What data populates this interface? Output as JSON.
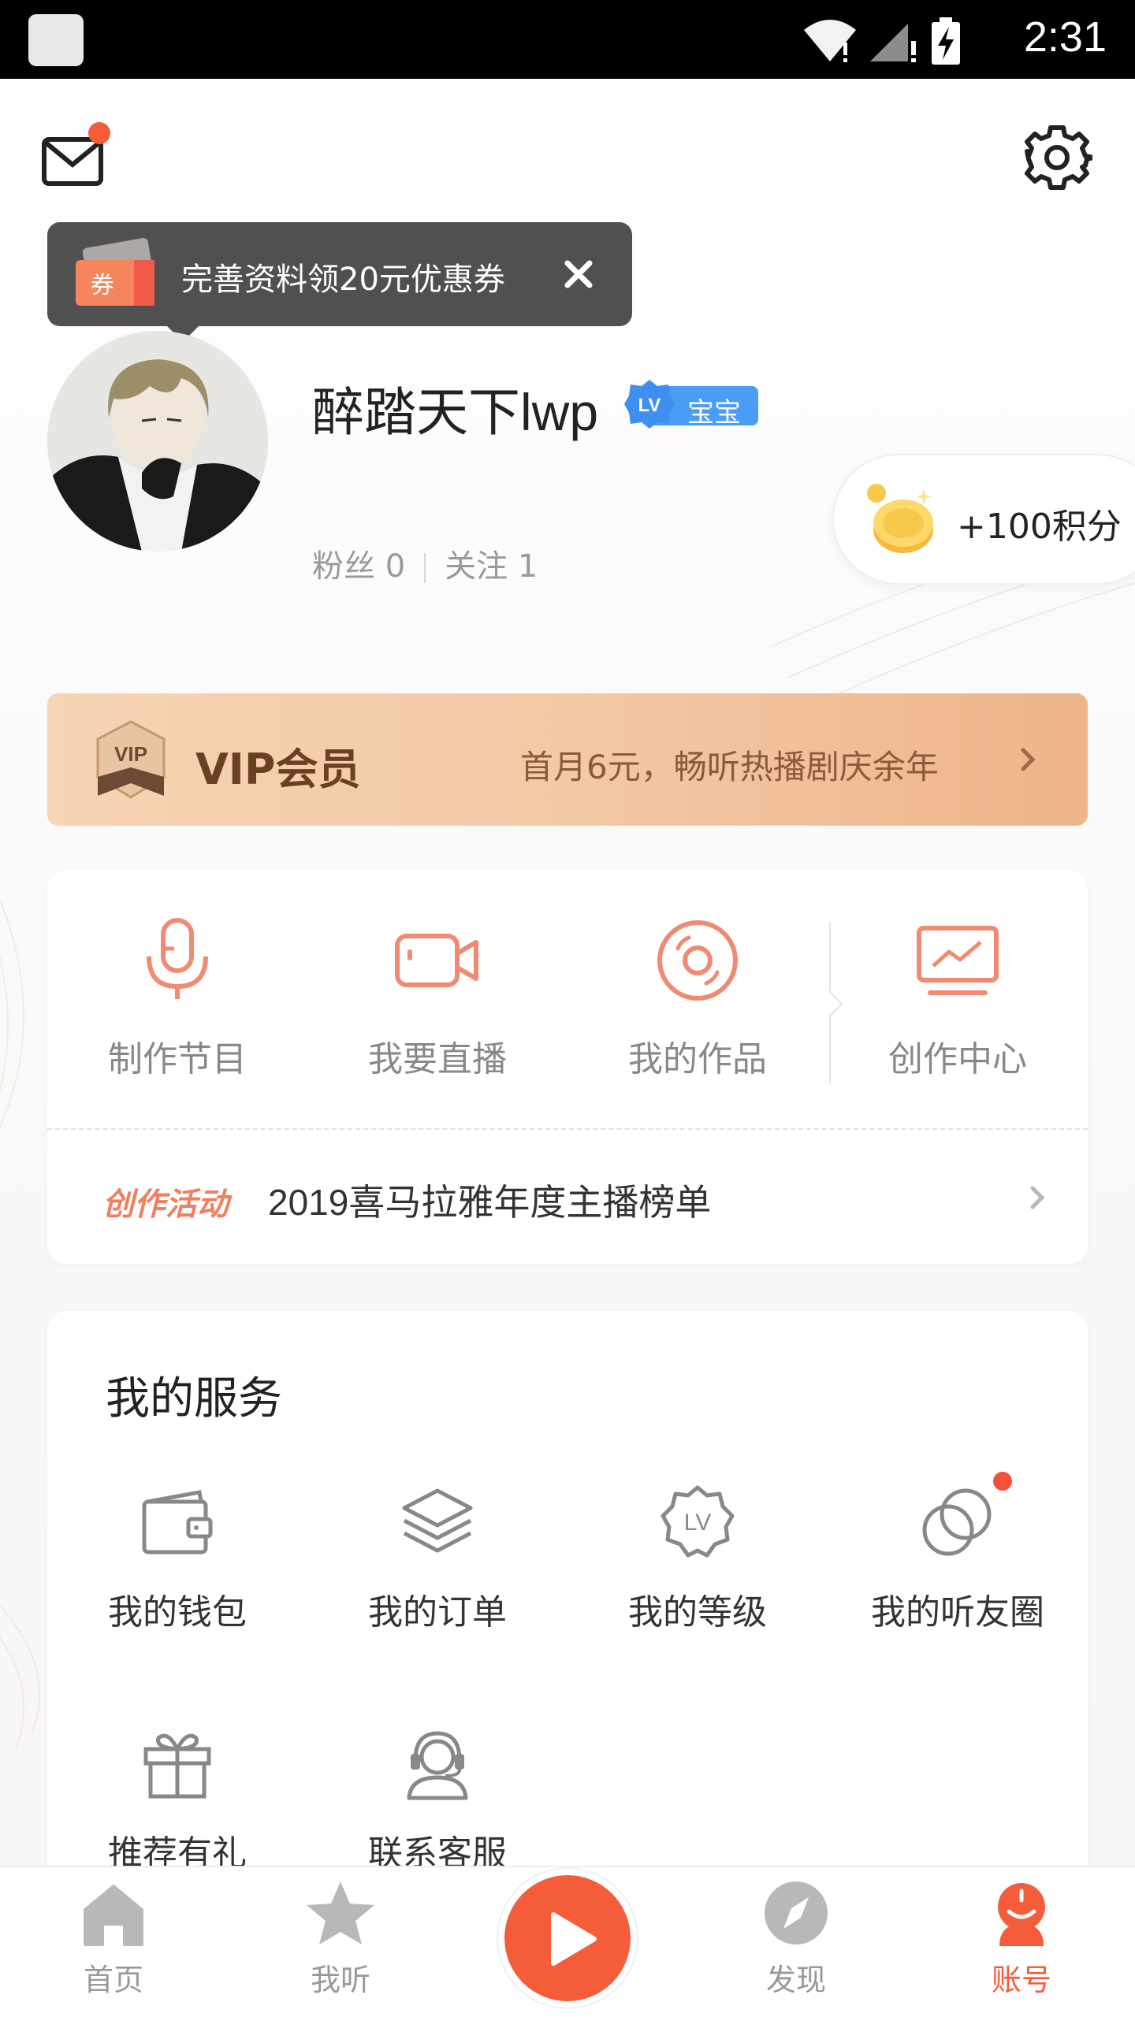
{
  "status_bar": {
    "time": "2:31"
  },
  "coupon_tip": {
    "text": "完善资料领20元优惠券",
    "ticket_label": "券"
  },
  "profile": {
    "username": "醉踏天下lwp",
    "level_badge": "宝宝",
    "level_prefix": "LV",
    "fans_label": "粉丝 0",
    "following_label": "关注 1"
  },
  "points": {
    "label": "+100积分"
  },
  "vip": {
    "title": "VIP会员",
    "promo": "首月6元，畅听热播剧庆余年",
    "emblem_text": "VIP"
  },
  "creator": {
    "items": [
      {
        "label": "制作节目",
        "icon": "microphone-icon"
      },
      {
        "label": "我要直播",
        "icon": "video-camera-icon"
      },
      {
        "label": "我的作品",
        "icon": "disc-icon"
      },
      {
        "label": "创作中心",
        "icon": "monitor-chart-icon"
      }
    ],
    "activity_tag": "创作活动",
    "activity_text": "2019喜马拉雅年度主播榜单"
  },
  "services": {
    "title": "我的服务",
    "items": [
      {
        "label": "我的钱包",
        "icon": "wallet-icon"
      },
      {
        "label": "我的订单",
        "icon": "layers-icon"
      },
      {
        "label": "我的等级",
        "icon": "level-badge-icon",
        "glyph": "LV"
      },
      {
        "label": "我的听友圈",
        "icon": "circles-icon"
      },
      {
        "label": "推荐有礼",
        "icon": "gift-icon"
      },
      {
        "label": "联系客服",
        "icon": "headset-icon"
      }
    ]
  },
  "tabbar": {
    "tabs": [
      {
        "label": "首页",
        "icon": "home-icon"
      },
      {
        "label": "我听",
        "icon": "star-icon"
      },
      {
        "label": "发现",
        "icon": "compass-icon"
      },
      {
        "label": "账号",
        "icon": "account-icon"
      }
    ],
    "active": "账号"
  },
  "colors": {
    "accent": "#f55d3a",
    "creator_icon": "#f08a72",
    "service_icon": "#888888"
  }
}
